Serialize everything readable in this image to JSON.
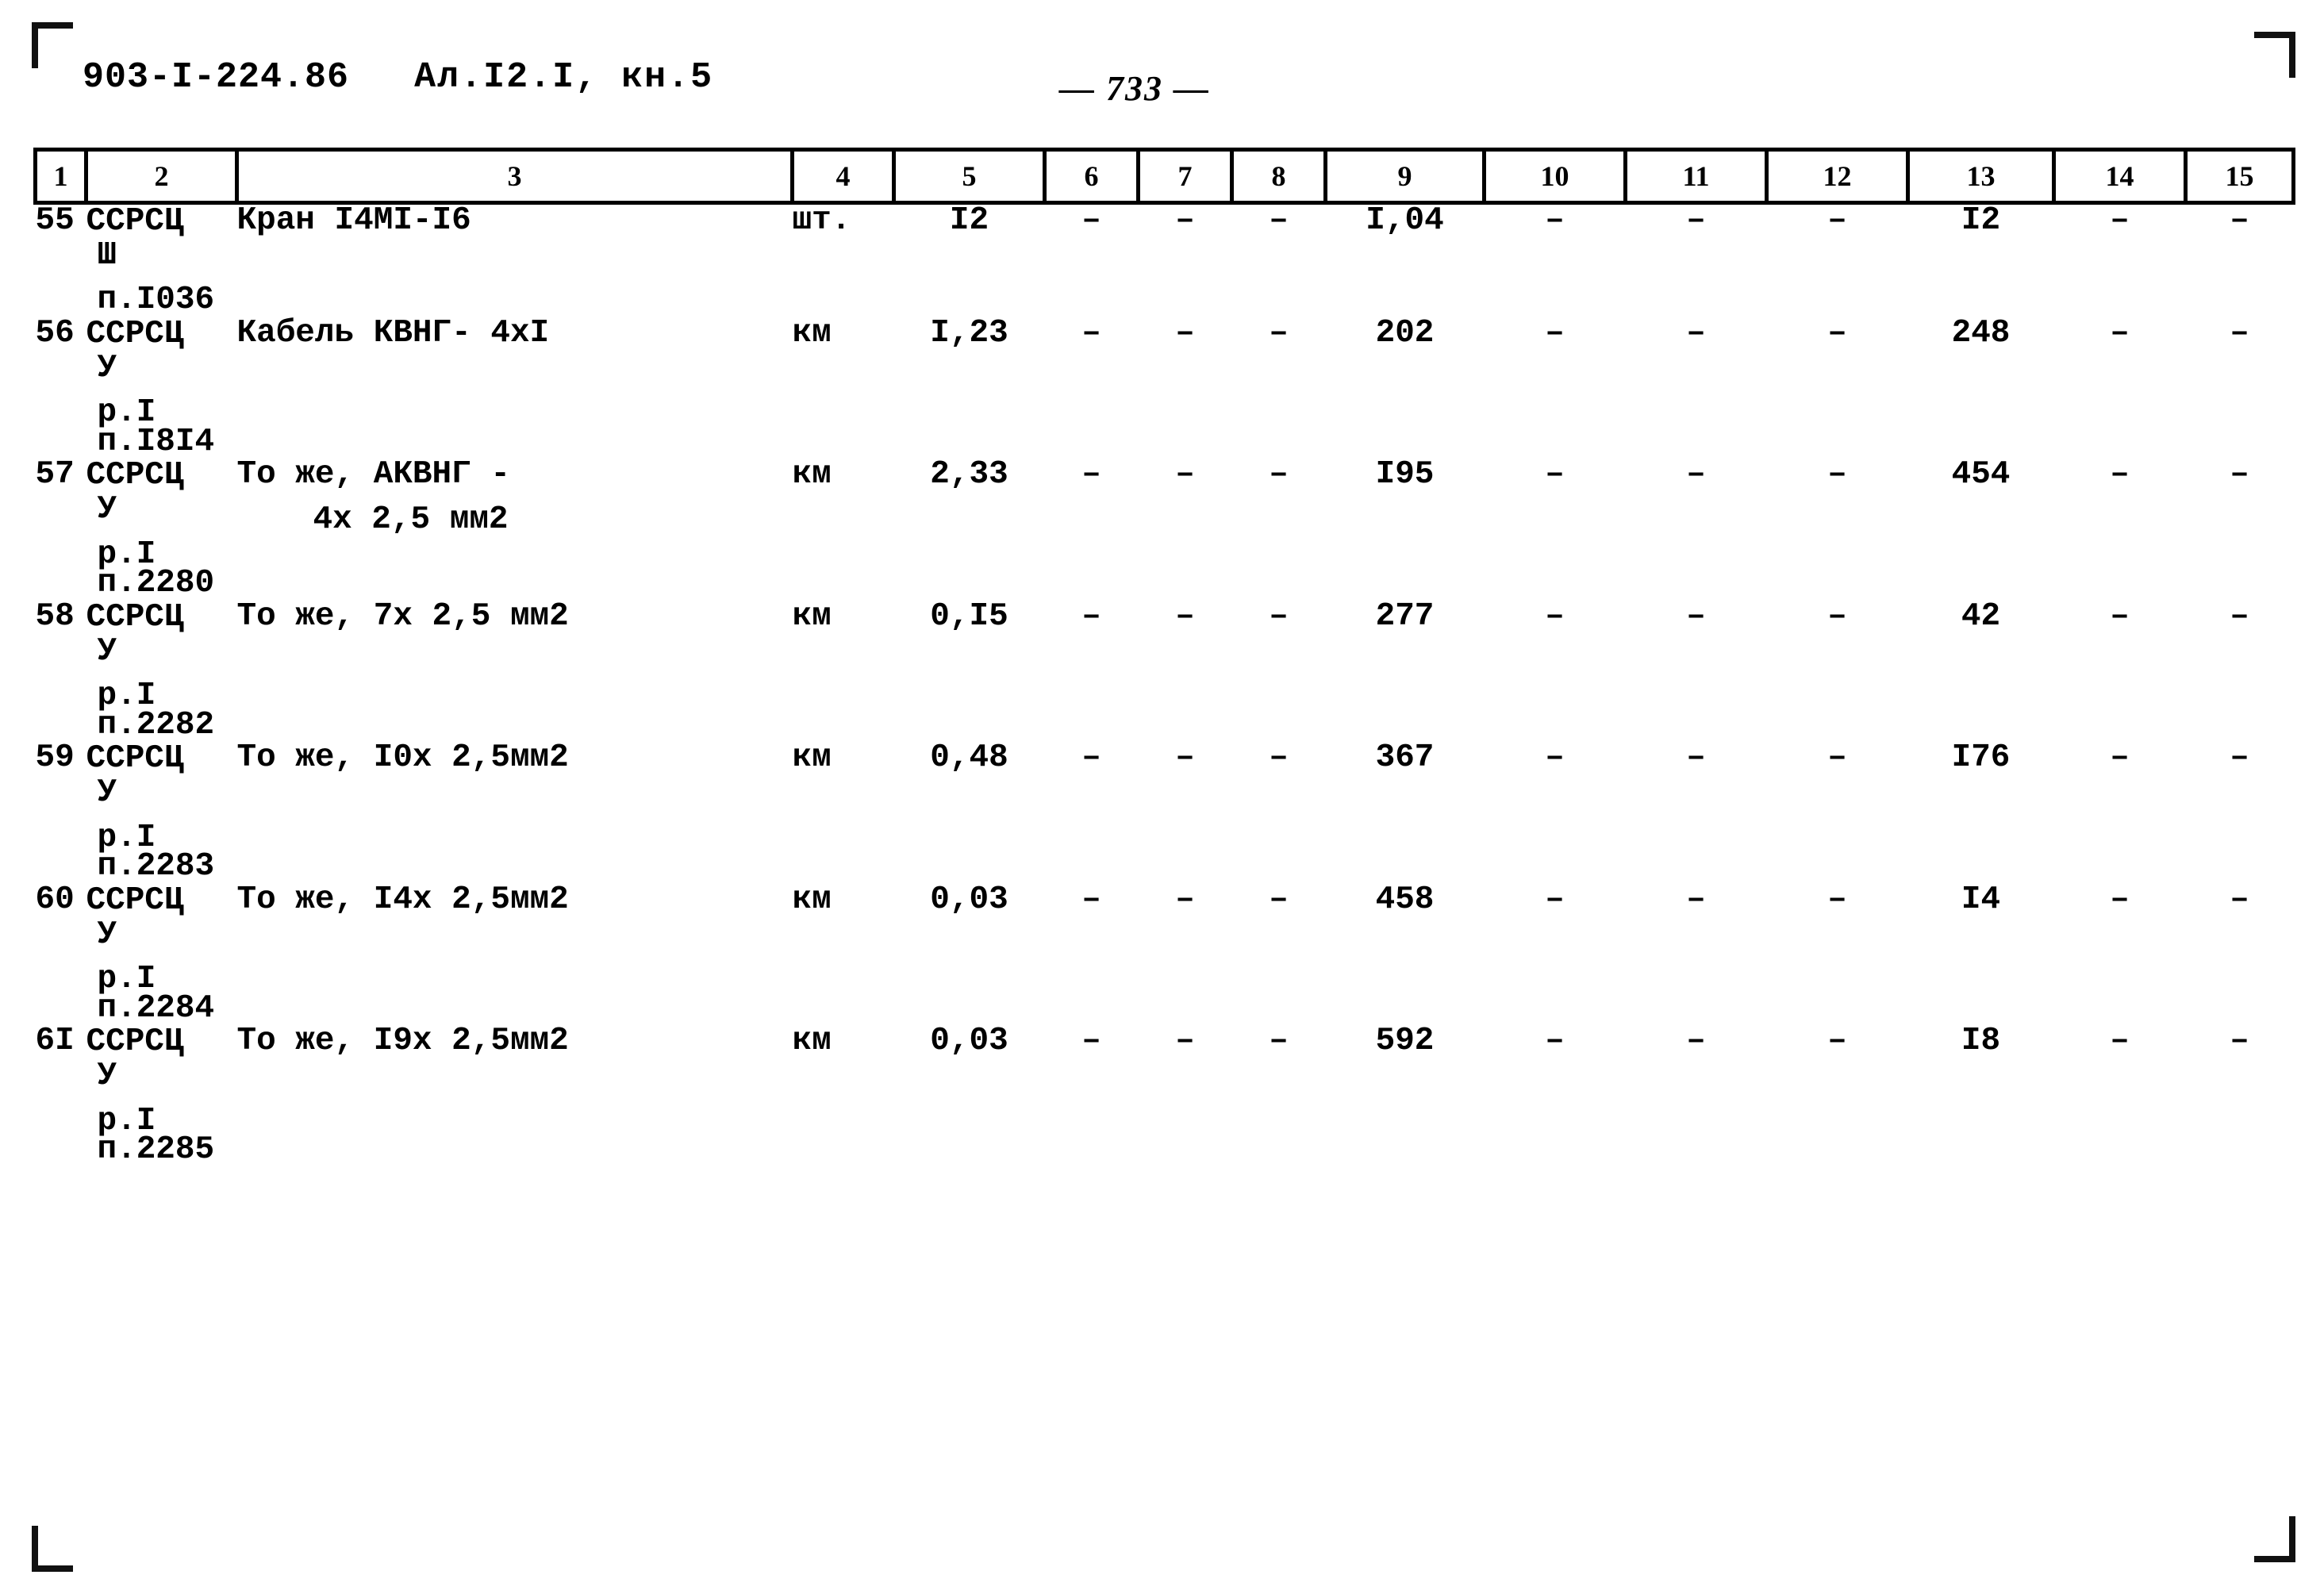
{
  "header": {
    "doc_code": "903-I-224.86",
    "album": "Ал.I2.I, кн.5",
    "page_number": "— 733 —"
  },
  "table": {
    "column_numbers": [
      "1",
      "2",
      "3",
      "4",
      "5",
      "6",
      "7",
      "8",
      "9",
      "10",
      "11",
      "12",
      "13",
      "14",
      "15"
    ],
    "rows": [
      {
        "num": "55",
        "justification_l1": "ССРСЦ",
        "justification_l2": "Ш",
        "justification_l3": "п.I036",
        "justification_l4": "",
        "name_l1": "Кран I4МI-I6",
        "name_l2": "",
        "unit": "шт.",
        "c5": "I2",
        "c6": "–",
        "c7": "–",
        "c8": "–",
        "c9": "I,04",
        "c10": "–",
        "c11": "–",
        "c12": "–",
        "c13": "I2",
        "c14": "–",
        "c15": "–"
      },
      {
        "num": "56",
        "justification_l1": "ССРСЦ",
        "justification_l2": "У",
        "justification_l3": "р.I",
        "justification_l4": "п.I8I4",
        "name_l1": "Кабель КВНГ- 4хI",
        "name_l2": "",
        "unit": "км",
        "c5": "I,23",
        "c6": "–",
        "c7": "–",
        "c8": "–",
        "c9": "202",
        "c10": "–",
        "c11": "–",
        "c12": "–",
        "c13": "248",
        "c14": "–",
        "c15": "–"
      },
      {
        "num": "57",
        "justification_l1": "ССРСЦ",
        "justification_l2": "У",
        "justification_l3": "р.I",
        "justification_l4": "п.2280",
        "name_l1": "То же, АКВНГ -",
        "name_l2": "4х 2,5 мм2",
        "unit": "км",
        "c5": "2,33",
        "c6": "–",
        "c7": "–",
        "c8": "–",
        "c9": "I95",
        "c10": "–",
        "c11": "–",
        "c12": "–",
        "c13": "454",
        "c14": "–",
        "c15": "–"
      },
      {
        "num": "58",
        "justification_l1": "ССРСЦ",
        "justification_l2": "У",
        "justification_l3": "р.I",
        "justification_l4": "п.2282",
        "name_l1": "То же, 7х 2,5 мм2",
        "name_l2": "",
        "unit": "км",
        "c5": "0,I5",
        "c6": "–",
        "c7": "–",
        "c8": "–",
        "c9": "277",
        "c10": "–",
        "c11": "–",
        "c12": "–",
        "c13": "42",
        "c14": "–",
        "c15": "–"
      },
      {
        "num": "59",
        "justification_l1": "ССРСЦ",
        "justification_l2": "У",
        "justification_l3": "р.I",
        "justification_l4": "п.2283",
        "name_l1": "То же, I0х 2,5мм2",
        "name_l2": "",
        "unit": "км",
        "c5": "0,48",
        "c6": "–",
        "c7": "–",
        "c8": "–",
        "c9": "367",
        "c10": "–",
        "c11": "–",
        "c12": "–",
        "c13": "I76",
        "c14": "–",
        "c15": "–"
      },
      {
        "num": "60",
        "justification_l1": "ССРСЦ",
        "justification_l2": "У",
        "justification_l3": "р.I",
        "justification_l4": "п.2284",
        "name_l1": "То же, I4х 2,5мм2",
        "name_l2": "",
        "unit": "км",
        "c5": "0,03",
        "c6": "–",
        "c7": "–",
        "c8": "–",
        "c9": "458",
        "c10": "–",
        "c11": "–",
        "c12": "–",
        "c13": "I4",
        "c14": "–",
        "c15": "–"
      },
      {
        "num": "6I",
        "justification_l1": "ССРСЦ",
        "justification_l2": "У",
        "justification_l3": "р.I",
        "justification_l4": "п.2285",
        "name_l1": "То же, I9х 2,5мм2",
        "name_l2": "",
        "unit": "км",
        "c5": "0,03",
        "c6": "–",
        "c7": "–",
        "c8": "–",
        "c9": "592",
        "c10": "–",
        "c11": "–",
        "c12": "–",
        "c13": "I8",
        "c14": "–",
        "c15": "–"
      }
    ]
  }
}
